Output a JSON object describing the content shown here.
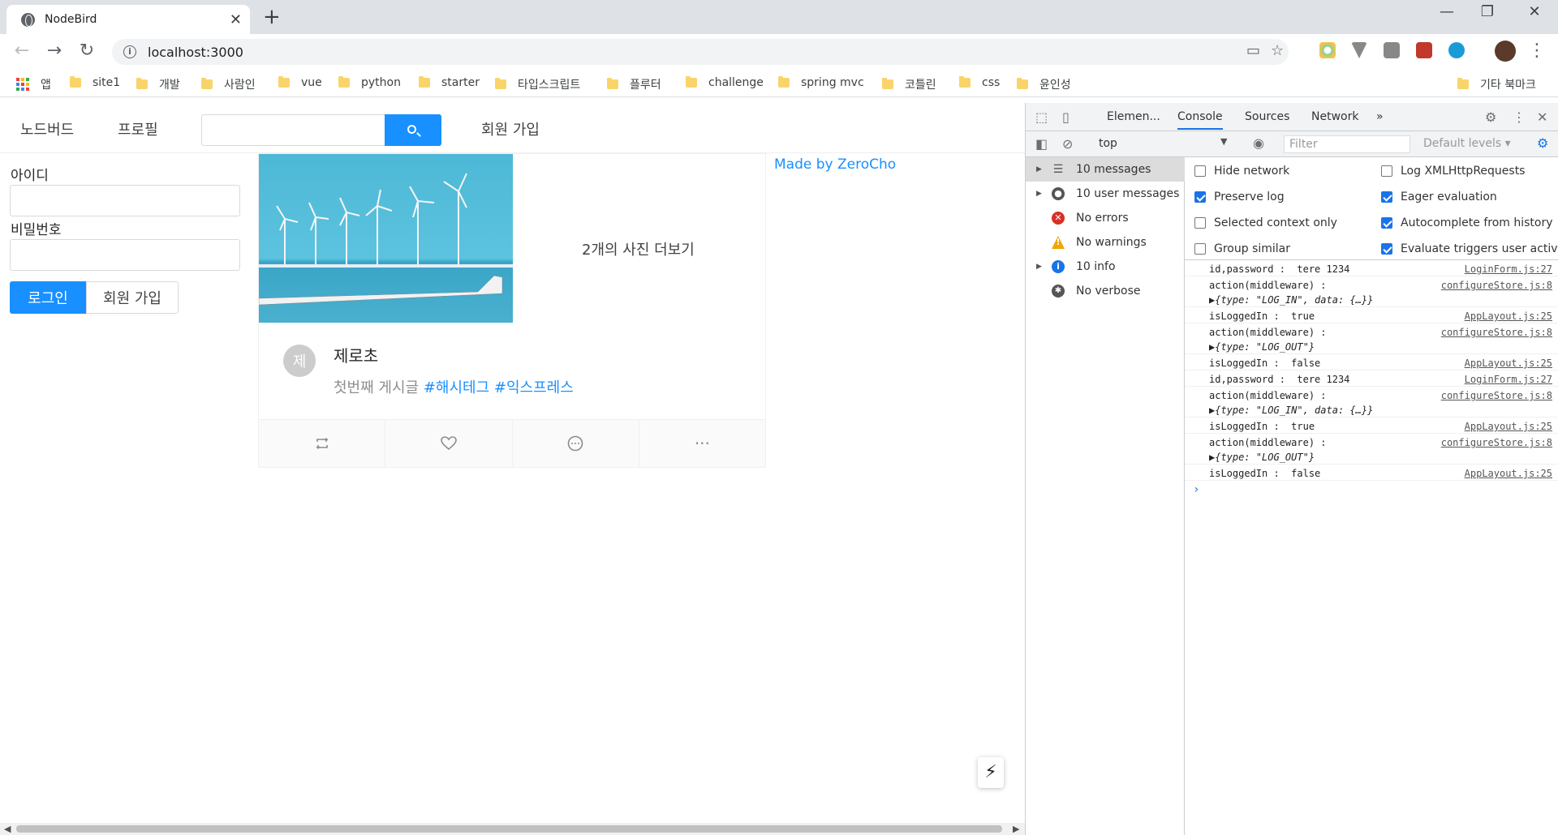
{
  "browser": {
    "tab_title": "NodeBird",
    "tab_close": "✕",
    "new_tab": "+",
    "url": "localhost:3000",
    "window_controls": [
      "—",
      "❐",
      "✕"
    ]
  },
  "bookmarks": {
    "apps_label": "앱",
    "items": [
      "site1",
      "개발",
      "사람인",
      "vue",
      "python",
      "starter",
      "타입스크립트",
      "플루터",
      "challenge",
      "spring mvc",
      "코틀린",
      "css",
      "윤인성"
    ],
    "other": "기타 북마크"
  },
  "menu": {
    "home": "노드버드",
    "profile": "프로필",
    "signup": "회원 가입"
  },
  "login": {
    "id_label": "아이디",
    "password_label": "비밀번호",
    "login_button": "로그인",
    "signup_button": "회원 가입"
  },
  "post": {
    "more_photos": "2개의 사진 더보기",
    "avatar_letter": "제",
    "author": "제로초",
    "content_text": "첫번째 게시글",
    "hashtags": [
      "#해시테그",
      "#익스프레스"
    ],
    "actions": [
      "retweet-icon",
      "heart-icon",
      "message-icon",
      "ellipsis-icon"
    ],
    "ellipsis": "···"
  },
  "made_by": "Made by ZeroCho",
  "devtools": {
    "tabs": [
      "Elemen...",
      "Console",
      "Sources",
      "Network"
    ],
    "active_tab": "Console",
    "more_tabs": "»",
    "context": "top",
    "filter_placeholder": "Filter",
    "levels": "Default levels ▾",
    "sidebar": [
      {
        "label": "10 messages",
        "selected": true
      },
      {
        "label": "10 user messages"
      },
      {
        "label": "No errors"
      },
      {
        "label": "No warnings"
      },
      {
        "label": "10 info"
      },
      {
        "label": "No verbose"
      }
    ],
    "settings": [
      {
        "label": "Hide network",
        "checked": false
      },
      {
        "label": "Log XMLHttpRequests",
        "checked": false
      },
      {
        "label": "Preserve log",
        "checked": true
      },
      {
        "label": "Eager evaluation",
        "checked": true
      },
      {
        "label": "Selected context only",
        "checked": false
      },
      {
        "label": "Autocomplete from history",
        "checked": true
      },
      {
        "label": "Group similar",
        "checked": false
      },
      {
        "label": "Evaluate triggers user activatio",
        "checked": true
      }
    ],
    "logs": [
      {
        "msg": "id,password :  tere 1234",
        "src": "LoginForm.js:27"
      },
      {
        "msg": "action(middleware) :",
        "src": "configureStore.js:8",
        "obj": "▶{type: \"LOG_IN\", data: {…}}"
      },
      {
        "msg": "isLoggedIn :  true",
        "src": "AppLayout.js:25"
      },
      {
        "msg": "action(middleware) :",
        "src": "configureStore.js:8",
        "obj": "▶{type: \"LOG_OUT\"}"
      },
      {
        "msg": "isLoggedIn :  false",
        "src": "AppLayout.js:25"
      },
      {
        "msg": "id,password :  tere 1234",
        "src": "LoginForm.js:27"
      },
      {
        "msg": "action(middleware) :",
        "src": "configureStore.js:8",
        "obj": "▶{type: \"LOG_IN\", data: {…}}"
      },
      {
        "msg": "isLoggedIn :  true",
        "src": "AppLayout.js:25"
      },
      {
        "msg": "action(middleware) :",
        "src": "configureStore.js:8",
        "obj": "▶{type: \"LOG_OUT\"}"
      },
      {
        "msg": "isLoggedIn :  false",
        "src": "AppLayout.js:25"
      }
    ],
    "prompt": "›"
  }
}
